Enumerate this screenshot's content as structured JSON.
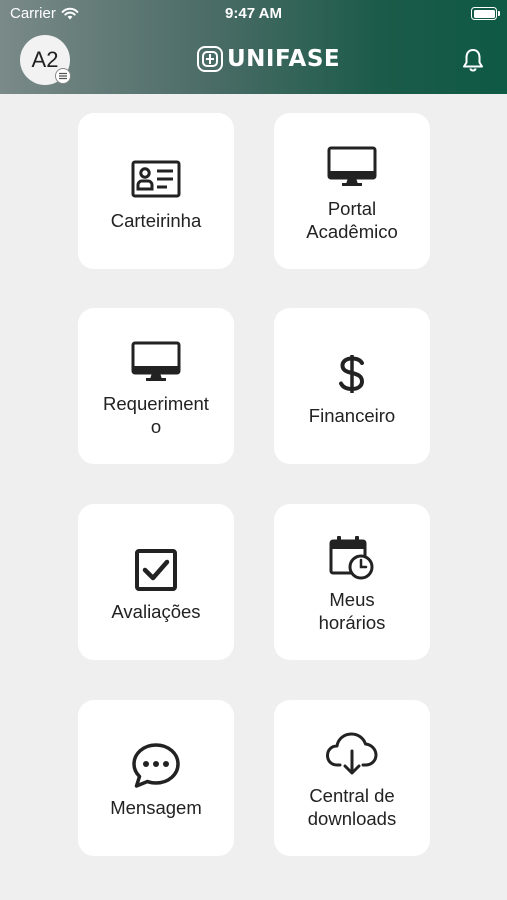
{
  "status_bar": {
    "carrier": "Carrier",
    "time": "9:47 AM"
  },
  "header": {
    "avatar_initials": "A2",
    "logo_text": "UNIFASE",
    "accent_color": "#0e5a44"
  },
  "menu": {
    "items": [
      {
        "label": "Carteirinha",
        "icon": "id-card-icon"
      },
      {
        "label": "Portal Acadêmico",
        "icon": "monitor-icon"
      },
      {
        "label": "Requeriment o",
        "icon": "monitor-icon"
      },
      {
        "label": "Financeiro",
        "icon": "dollar-icon"
      },
      {
        "label": "Avaliações",
        "icon": "checkbox-icon"
      },
      {
        "label": "Meus horários",
        "icon": "calendar-clock-icon"
      },
      {
        "label": "Mensagem",
        "icon": "chat-bubble-icon"
      },
      {
        "label": "Central de downloads",
        "icon": "cloud-download-icon"
      }
    ]
  }
}
